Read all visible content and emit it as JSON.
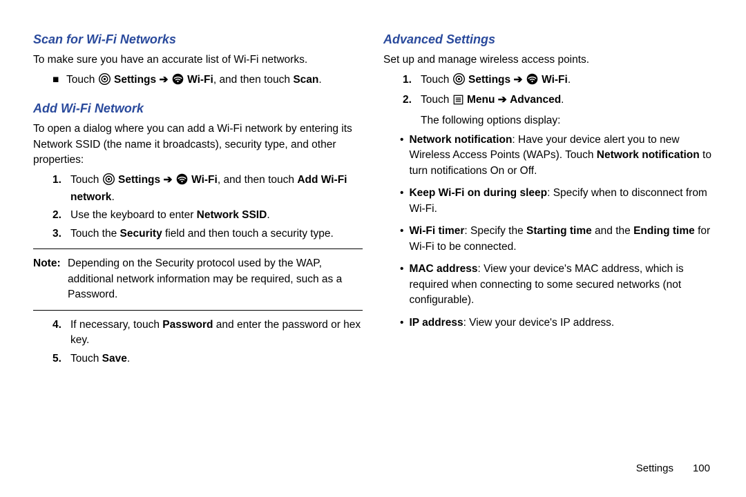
{
  "left": {
    "h1": "Scan for Wi-Fi Networks",
    "p1": "To make sure you have an accurate list of Wi-Fi networks.",
    "b1_pre": "Touch ",
    "b1_settings": "Settings",
    "b1_wifi": "Wi-Fi",
    "b1_mid": ", and then touch ",
    "b1_scan": "Scan",
    "h2": "Add Wi-Fi Network",
    "p2": "To open a dialog where you can add a Wi-Fi network by entering its Network SSID (the name it broadcasts), security type, and other properties:",
    "s1_pre": "Touch ",
    "s1_settings": "Settings",
    "s1_wifi": "Wi-Fi",
    "s1_mid": ", and then touch ",
    "s1_add": "Add Wi-Fi network",
    "s2_pre": "Use the keyboard to enter ",
    "s2_ssid": "Network SSID",
    "s3_pre": "Touch the ",
    "s3_sec": "Security",
    "s3_post": " field and then touch a security type.",
    "note_label": "Note:",
    "note_text": "Depending on the Security protocol used by the WAP, additional network information may be required, such as a Password.",
    "s4_pre": "If necessary, touch ",
    "s4_pw": "Password",
    "s4_post": " and enter the password or hex key.",
    "s5_pre": "Touch ",
    "s5_save": "Save"
  },
  "right": {
    "h1": "Advanced Settings",
    "p1": "Set up and manage wireless access points.",
    "s1_pre": "Touch ",
    "s1_settings": "Settings",
    "s1_wifi": "Wi-Fi",
    "s2_pre": "Touch ",
    "s2_menu": "Menu",
    "s2_adv": "Advanced",
    "s2_post": "The following options display:",
    "o1_t": "Network notification",
    "o1_a": ": Have your device alert you to new Wireless Access Points (WAPs). Touch ",
    "o1_b": "Network notification",
    "o1_c": " to turn notifications On or Off.",
    "o2_t": "Keep Wi-Fi on during sleep",
    "o2_a": ": Specify when to disconnect from Wi-Fi.",
    "o3_t": "Wi-Fi timer",
    "o3_a": ": Specify the ",
    "o3_b": "Starting time",
    "o3_c": " and the ",
    "o3_d": "Ending time",
    "o3_e": " for Wi-Fi to be connected.",
    "o4_t": "MAC address",
    "o4_a": ": View your device's MAC address, which is required when connecting to some secured networks (not configurable).",
    "o5_t": "IP address",
    "o5_a": ": View your device's IP address."
  },
  "footer": {
    "section": "Settings",
    "page": "100"
  },
  "num": {
    "n1": "1.",
    "n2": "2.",
    "n3": "3.",
    "n4": "4.",
    "n5": "5."
  },
  "arrow": "➔",
  "square": "■",
  "bullet": "•",
  "dot": "."
}
